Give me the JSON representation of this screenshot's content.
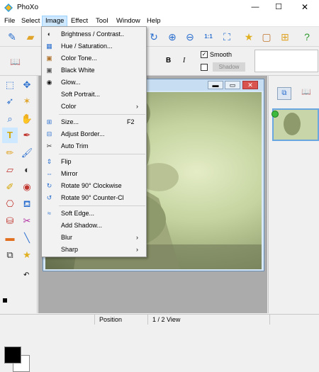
{
  "app": {
    "title": "PhoXo"
  },
  "window_controls": {
    "minimize": "—",
    "maximize": "☐",
    "close": "✕"
  },
  "menubar": {
    "items": [
      "File",
      "Select",
      "Image",
      "Effect",
      "Tool",
      "Window",
      "Help"
    ],
    "active": "Image"
  },
  "toolbar2": {
    "smooth_label": "Smooth",
    "shadow_label": "Shadow",
    "bold": "B",
    "italic": "I"
  },
  "image_menu": {
    "items": [
      {
        "label": "Brightness / Contrast..",
        "icon": "brightness-icon",
        "glyph": "◐",
        "color": "#222222"
      },
      {
        "label": "Hue / Saturation...",
        "icon": "hue-icon",
        "glyph": "▦",
        "color": "#2a6fcf"
      },
      {
        "label": "Color Tone...",
        "icon": "color-tone-icon",
        "glyph": "▣",
        "color": "#b0742e"
      },
      {
        "label": "Black White",
        "icon": "black-white-icon",
        "glyph": "▣",
        "color": "#555555"
      },
      {
        "label": "Glow...",
        "icon": "glow-icon",
        "glyph": "◉",
        "color": "#111111"
      },
      {
        "label": "Soft Portrait...",
        "icon": "",
        "glyph": "",
        "color": "#000000"
      },
      {
        "label": "Color",
        "icon": "",
        "glyph": "",
        "color": "#000000",
        "submenu": true
      },
      {
        "separator": true
      },
      {
        "label": "Size...",
        "icon": "size-icon",
        "glyph": "⊞",
        "color": "#2a6fcf",
        "shortcut": "F2"
      },
      {
        "label": "Adjust Border...",
        "icon": "border-icon",
        "glyph": "⊟",
        "color": "#2a6fcf"
      },
      {
        "label": "Auto Trim",
        "icon": "trim-icon",
        "glyph": "✂",
        "color": "#333333"
      },
      {
        "separator": true
      },
      {
        "label": "Flip",
        "icon": "flip-icon",
        "glyph": "⇕",
        "color": "#2a6fcf"
      },
      {
        "label": "Mirror",
        "icon": "mirror-icon",
        "glyph": "⇔",
        "color": "#2a6fcf"
      },
      {
        "label": "Rotate 90° Clockwise",
        "icon": "rotate-cw-icon",
        "glyph": "↻",
        "color": "#2a6fcf"
      },
      {
        "label": "Rotate 90° Counter-Cl",
        "icon": "rotate-ccw-icon",
        "glyph": "↺",
        "color": "#2a6fcf"
      },
      {
        "separator": true
      },
      {
        "label": "Soft Edge...",
        "icon": "soft-edge-icon",
        "glyph": "≈",
        "color": "#2a6fcf"
      },
      {
        "label": "Add Shadow...",
        "icon": "",
        "glyph": "",
        "color": "#000000"
      },
      {
        "label": "Blur",
        "icon": "",
        "glyph": "",
        "color": "#000000",
        "submenu": true
      },
      {
        "label": "Sharp",
        "icon": "",
        "glyph": "",
        "color": "#000000",
        "submenu": true
      }
    ]
  },
  "statusbar": {
    "position_label": "Position",
    "view_label": "1 / 2 View"
  }
}
